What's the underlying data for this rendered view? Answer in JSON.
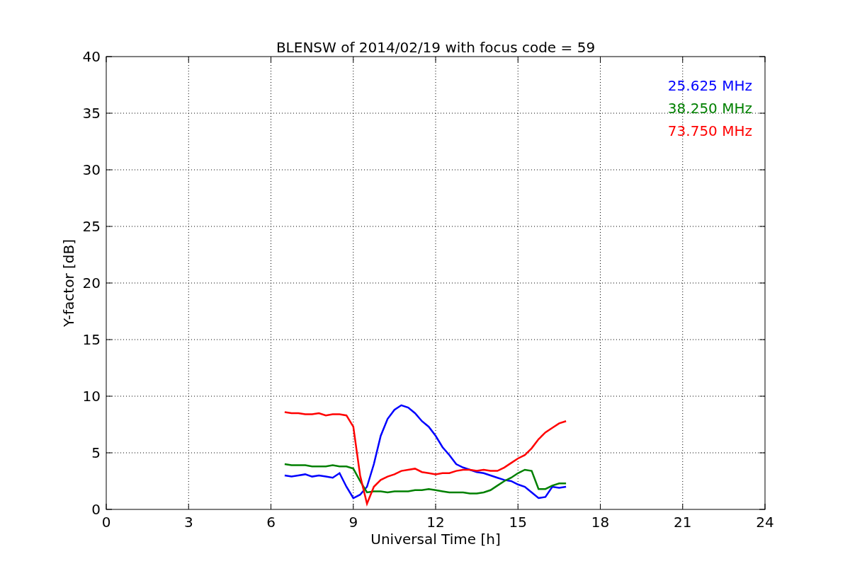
{
  "chart_data": {
    "type": "line",
    "title": "BLENSW of 2014/02/19 with focus code = 59",
    "xlabel": "Universal Time [h]",
    "ylabel": "Y-factor [dB]",
    "x": [
      6.5,
      6.75,
      7,
      7.25,
      7.5,
      7.75,
      8,
      8.25,
      8.5,
      8.75,
      9,
      9.25,
      9.5,
      9.75,
      10,
      10.25,
      10.5,
      10.75,
      11,
      11.25,
      11.5,
      11.75,
      12,
      12.25,
      12.5,
      12.75,
      13,
      13.25,
      13.5,
      13.75,
      14,
      14.25,
      14.5,
      14.75,
      15,
      15.25,
      15.5,
      15.75,
      16,
      16.25,
      16.5,
      16.75
    ],
    "series": [
      {
        "name": "25.625 MHz",
        "color": "#0000ff",
        "values": [
          3.0,
          2.9,
          3.0,
          3.1,
          2.9,
          3.0,
          2.9,
          2.8,
          3.2,
          2.0,
          1.0,
          1.3,
          2.0,
          4.0,
          6.5,
          8.0,
          8.8,
          9.2,
          9.0,
          8.5,
          7.8,
          7.3,
          6.5,
          5.5,
          4.8,
          4.0,
          3.7,
          3.5,
          3.3,
          3.2,
          3.0,
          2.8,
          2.6,
          2.5,
          2.2,
          2.0,
          1.5,
          1.0,
          1.1,
          2.0,
          1.9,
          2.0
        ]
      },
      {
        "name": "38.250 MHz",
        "color": "#008000",
        "values": [
          4.0,
          3.9,
          3.9,
          3.9,
          3.8,
          3.8,
          3.8,
          3.9,
          3.8,
          3.8,
          3.6,
          2.5,
          1.5,
          1.6,
          1.6,
          1.5,
          1.6,
          1.6,
          1.6,
          1.7,
          1.7,
          1.8,
          1.7,
          1.6,
          1.5,
          1.5,
          1.5,
          1.4,
          1.4,
          1.5,
          1.7,
          2.1,
          2.5,
          2.8,
          3.2,
          3.5,
          3.4,
          1.8,
          1.8,
          2.1,
          2.3,
          2.3
        ]
      },
      {
        "name": "73.750 MHz",
        "color": "#ff0000",
        "values": [
          8.6,
          8.5,
          8.5,
          8.4,
          8.4,
          8.5,
          8.3,
          8.4,
          8.4,
          8.3,
          7.3,
          3.0,
          0.5,
          2.0,
          2.6,
          2.9,
          3.1,
          3.4,
          3.5,
          3.6,
          3.3,
          3.2,
          3.1,
          3.2,
          3.2,
          3.4,
          3.5,
          3.5,
          3.4,
          3.5,
          3.4,
          3.4,
          3.7,
          4.1,
          4.5,
          4.8,
          5.4,
          6.2,
          6.8,
          7.2,
          7.6,
          7.8
        ]
      }
    ],
    "grid": true,
    "xlim": [
      0,
      24
    ],
    "ylim": [
      0,
      40
    ],
    "xticks": [
      0,
      3,
      6,
      9,
      12,
      15,
      18,
      21,
      24
    ],
    "yticks": [
      0,
      5,
      10,
      15,
      20,
      25,
      30,
      35,
      40
    ]
  }
}
